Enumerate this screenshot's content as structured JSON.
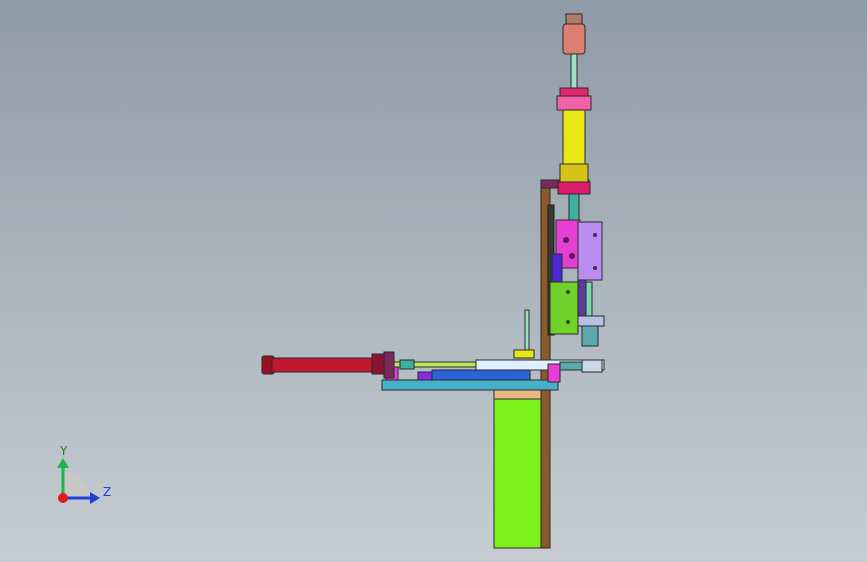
{
  "view": {
    "triad": {
      "y_label": "Y",
      "z_label": "Z",
      "y_color": "#22b14c",
      "z_color": "#1f3fd8",
      "origin_color": "#e01b1b"
    },
    "background": {
      "top": "#8e9aa6",
      "bottom": "#c6ccd2"
    }
  },
  "model": {
    "colors": {
      "vertical_cylinder_body": "#e8e816",
      "vertical_cylinder_cap": "#d9806e",
      "horizontal_cylinder_body": "#c2182f",
      "base_block": "#7df21a",
      "frame_post": "#8a5a2b",
      "slide_block_magenta": "#e63fd4",
      "slide_plate_lavender": "#b98ef0",
      "platform_blue": "#46b0c8",
      "rail_white": "#dff0ff",
      "green_block": "#6fd12a"
    }
  }
}
